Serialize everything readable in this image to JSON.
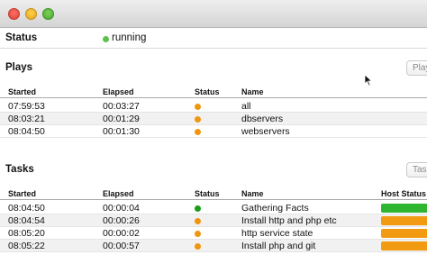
{
  "status": {
    "label": "Status",
    "value": "running",
    "dot_color": "#5cc24a"
  },
  "plays": {
    "title": "Plays",
    "button_label": "Play",
    "columns": {
      "started": "Started",
      "elapsed": "Elapsed",
      "status": "Status",
      "name": "Name"
    },
    "rows": [
      {
        "started": "07:59:53",
        "elapsed": "00:03:27",
        "status_color": "#f0960e",
        "name": "all"
      },
      {
        "started": "08:03:21",
        "elapsed": "00:01:29",
        "status_color": "#f0960e",
        "name": "dbservers"
      },
      {
        "started": "08:04:50",
        "elapsed": "00:01:30",
        "status_color": "#f0960e",
        "name": "webservers"
      }
    ]
  },
  "tasks": {
    "title": "Tasks",
    "button_label": "Tas",
    "columns": {
      "started": "Started",
      "elapsed": "Elapsed",
      "status": "Status",
      "name": "Name",
      "host_status": "Host Status"
    },
    "rows": [
      {
        "started": "08:04:50",
        "elapsed": "00:00:04",
        "status_color": "#1a9e1a",
        "name": "Gathering Facts",
        "host_color": "#2fb52f"
      },
      {
        "started": "08:04:54",
        "elapsed": "00:00:26",
        "status_color": "#f0960e",
        "name": "Install http and php etc",
        "host_color": "#f29a12"
      },
      {
        "started": "08:05:20",
        "elapsed": "00:00:02",
        "status_color": "#f0960e",
        "name": "http service state",
        "host_color": "#f29a12"
      },
      {
        "started": "08:05:22",
        "elapsed": "00:00:57",
        "status_color": "#f0960e",
        "name": "Install php and git",
        "host_color": "#f29a12"
      }
    ]
  }
}
